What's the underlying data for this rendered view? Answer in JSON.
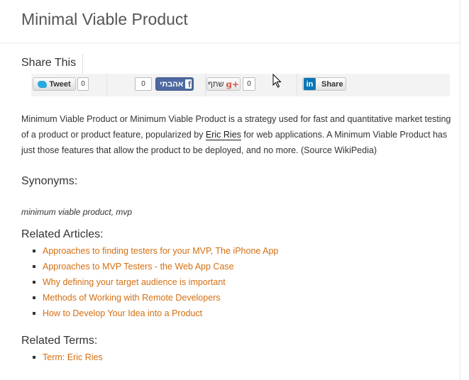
{
  "page": {
    "title": "Minimal Viable Product"
  },
  "share": {
    "heading": "Share This",
    "twitter": {
      "label": "Tweet",
      "count": "0",
      "icon": "twitter-bird-icon"
    },
    "facebook": {
      "label": "אהבתי",
      "count": "0",
      "icon": "facebook-icon"
    },
    "google_plus": {
      "label": "שתף",
      "icon_text": "g+",
      "count": "0"
    },
    "linkedin": {
      "icon_text": "in",
      "label": "Share"
    }
  },
  "intro": {
    "part1": "Minimum Viable Product or Minimum Viable Product is a strategy used for fast and quantitative market testing of a product or product feature, popularized by ",
    "link": "Eric Ries",
    "part2": " for web applications. A Minimum Viable Product has just those features that allow the product to be deployed, and no more. (Source WikiPedia)"
  },
  "synonyms": {
    "title": "Synonyms:",
    "text": "minimum viable product, mvp"
  },
  "related_articles": {
    "title": "Related Articles:",
    "items": [
      "Approaches to finding testers for your MVP, The iPhone App",
      "Approaches to MVP Testers - the Web App Case",
      "Why defining your target audience is important",
      "Methods of Working with Remote Developers",
      "How to Develop Your Idea into a Product"
    ]
  },
  "related_terms": {
    "title": "Related Terms:",
    "items": [
      "Term: Eric Ries"
    ]
  },
  "colors": {
    "link": "#d46f12",
    "facebook": "#4e69a2",
    "linkedin": "#0b77b5",
    "twitter": "#2aa9e0",
    "google_plus": "#dd4b39"
  }
}
